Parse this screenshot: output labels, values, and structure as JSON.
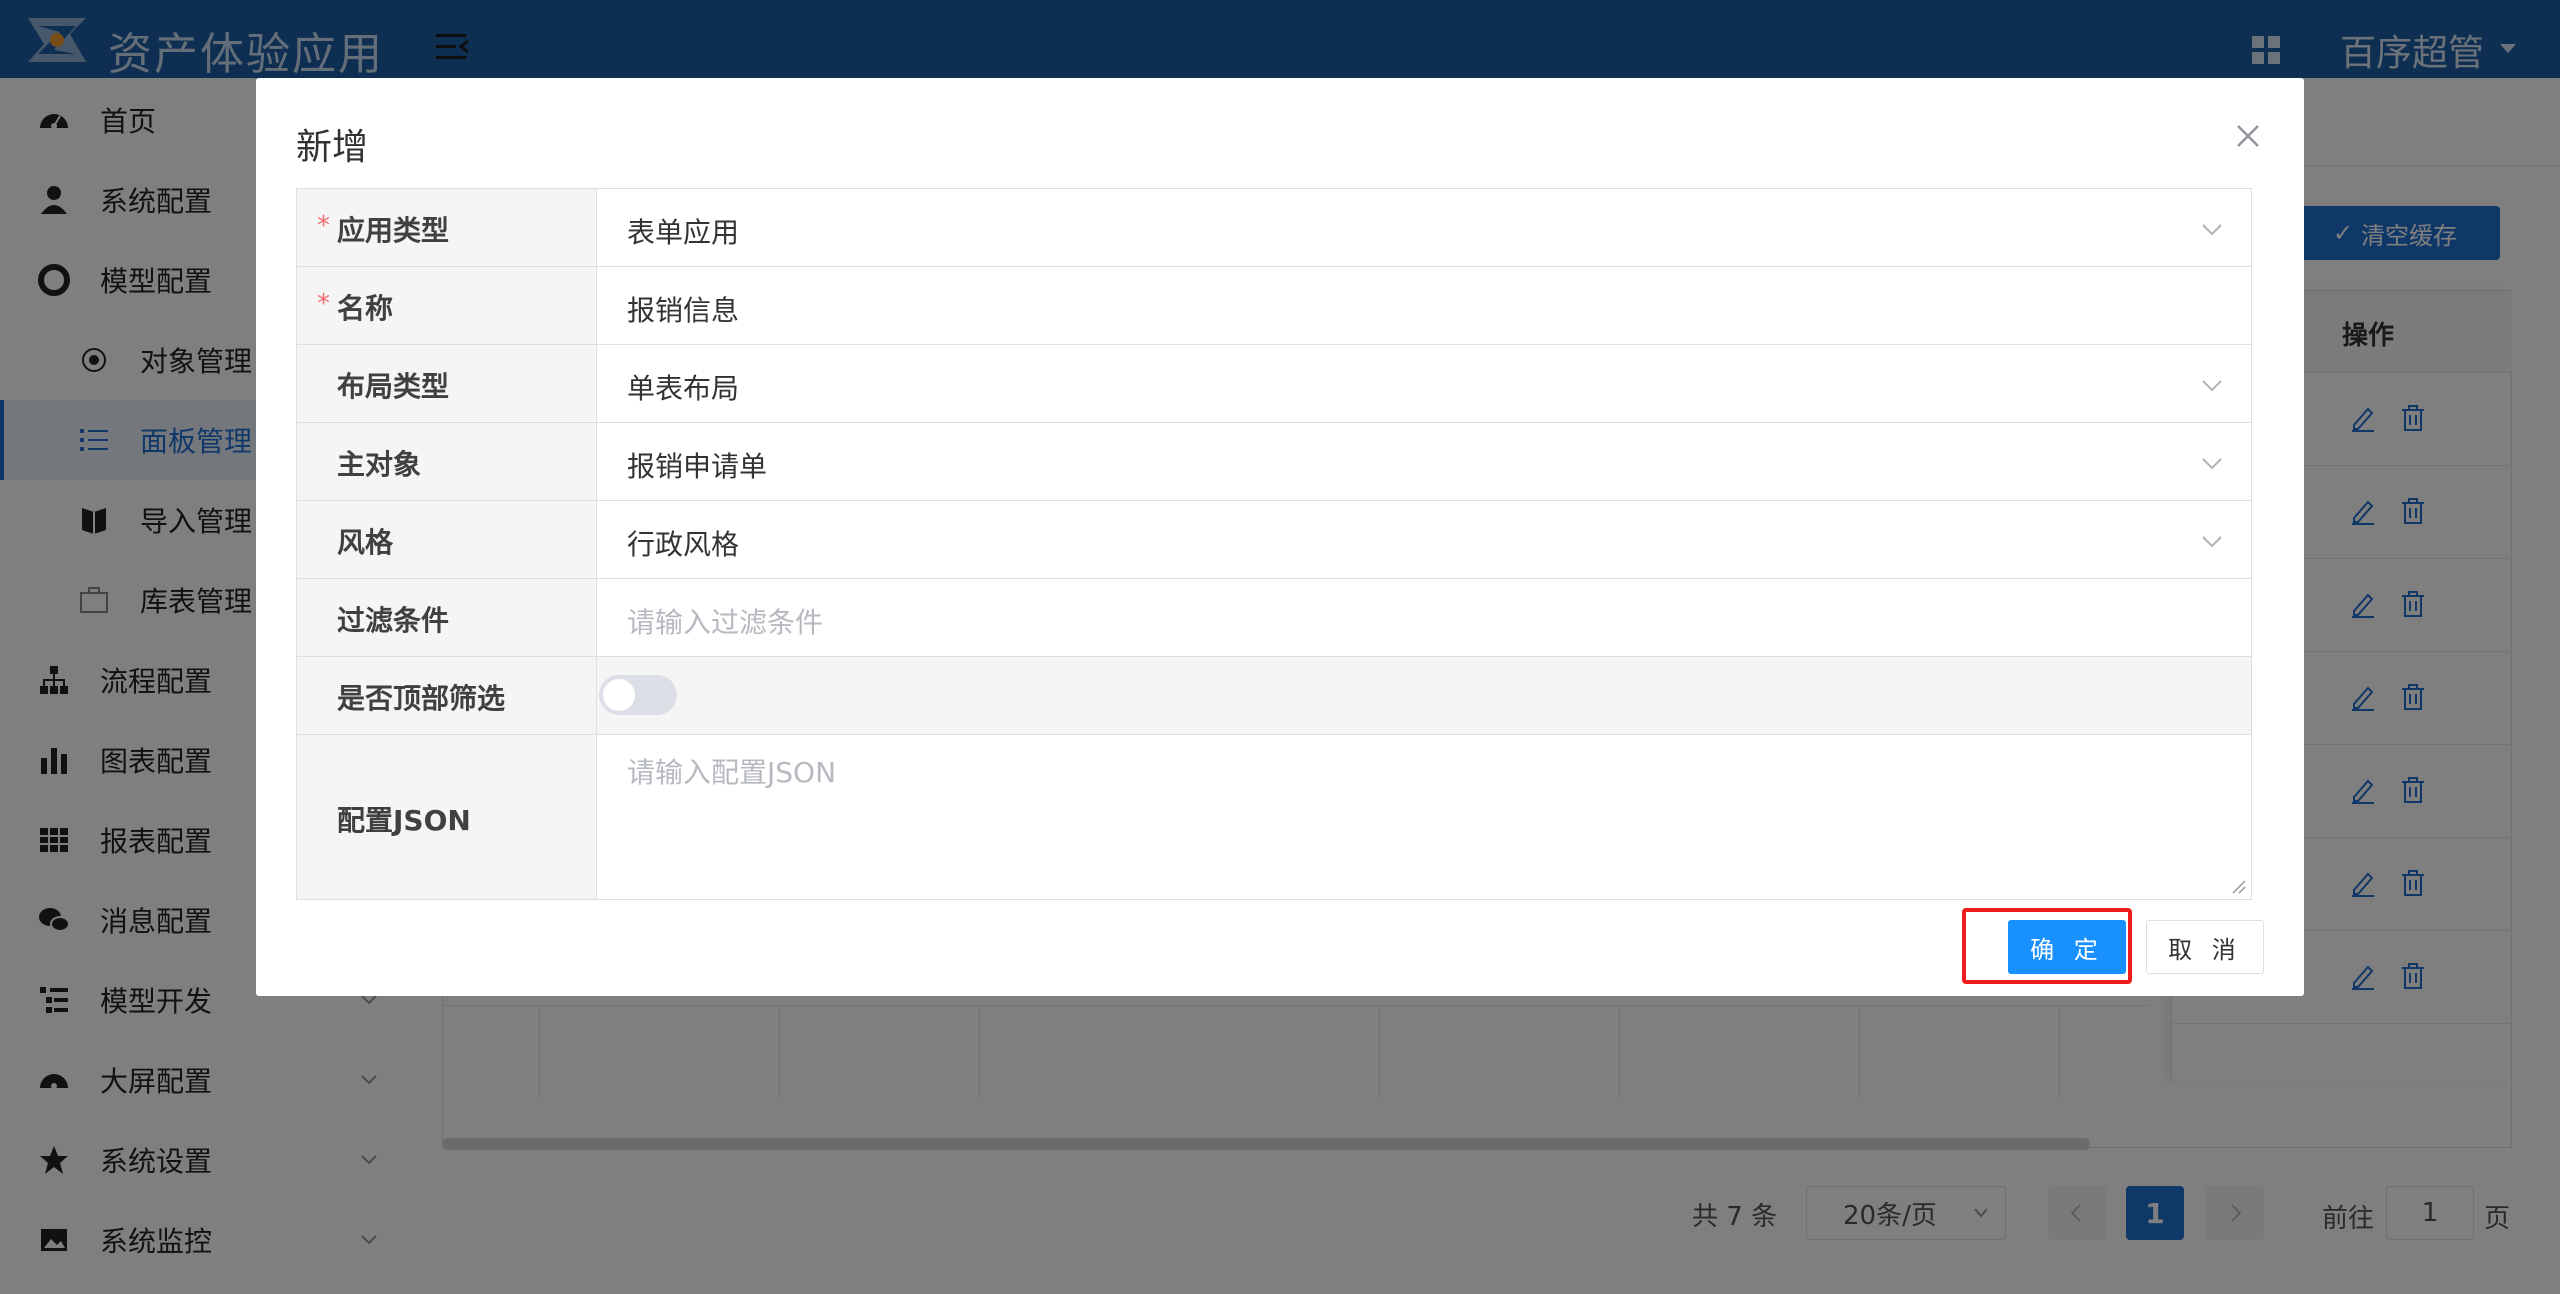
{
  "header": {
    "app_title": "资产体验应用",
    "user_name": "百序超管"
  },
  "sidebar": {
    "items": [
      {
        "label": "首页",
        "icon": "dashboard-icon"
      },
      {
        "label": "系统配置",
        "icon": "user-icon"
      },
      {
        "label": "模型配置",
        "icon": "lifebuoy-icon"
      },
      {
        "label": "对象管理",
        "icon": "radio-dot-icon"
      },
      {
        "label": "面板管理",
        "icon": "list-icon",
        "active": true
      },
      {
        "label": "导入管理",
        "icon": "book-icon"
      },
      {
        "label": "库表管理",
        "icon": "briefcase-icon"
      },
      {
        "label": "流程配置",
        "icon": "sitemap-icon"
      },
      {
        "label": "图表配置",
        "icon": "bar-chart-icon"
      },
      {
        "label": "报表配置",
        "icon": "table-icon"
      },
      {
        "label": "消息配置",
        "icon": "wechat-icon"
      },
      {
        "label": "模型开发",
        "icon": "tree-list-icon"
      },
      {
        "label": "大屏配置",
        "icon": "gauge-icon"
      },
      {
        "label": "系统设置",
        "icon": "star-icon"
      },
      {
        "label": "系统监控",
        "icon": "image-icon"
      }
    ]
  },
  "toolbar": {
    "clear_cache_label": "清空缓存"
  },
  "table": {
    "op_header": "操作"
  },
  "pagination": {
    "total": "共 7 条",
    "page_size": "20条/页",
    "current_page": "1",
    "goto_label": "前往",
    "goto_value": "1",
    "page_suffix": "页"
  },
  "dialog": {
    "title": "新增",
    "fields": {
      "app_type": {
        "label": "应用类型",
        "value": "表单应用",
        "required": "*"
      },
      "name": {
        "label": "名称",
        "value": "报销信息",
        "required": "*"
      },
      "layout_type": {
        "label": "布局类型",
        "value": "单表布局"
      },
      "main_object": {
        "label": "主对象",
        "value": "报销申请单"
      },
      "style": {
        "label": "风格",
        "value": "行政风格"
      },
      "filter": {
        "label": "过滤条件",
        "placeholder": "请输入过滤条件"
      },
      "top_filter": {
        "label": "是否顶部筛选",
        "checked": false
      },
      "config_json": {
        "label": "配置JSON",
        "placeholder": "请输入配置JSON"
      }
    },
    "ok_label": "确 定",
    "cancel_label": "取 消"
  },
  "colors": {
    "header_bg": "#1e5fa5",
    "primary": "#1890ff",
    "highlight": "#ee1c1c",
    "required": "#f56c6c"
  }
}
